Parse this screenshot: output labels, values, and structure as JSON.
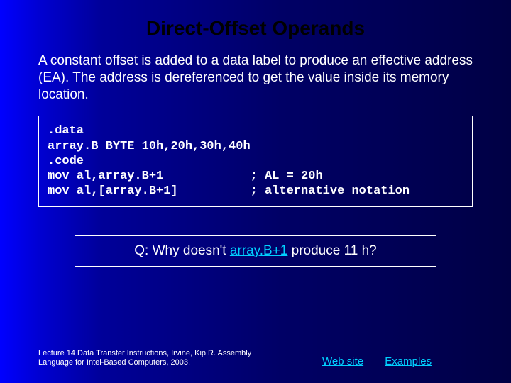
{
  "title": "Direct-Offset Operands",
  "body": "A constant offset is added to a data label to produce an effective address (EA). The address is dereferenced to get the value inside its memory location.",
  "code": ".data\narray.B BYTE 10h,20h,30h,40h\n.code\nmov al,array.B+1            ; AL = 20h\nmov al,[array.B+1]          ; alternative notation",
  "question": {
    "prefix": "Q: Why doesn't ",
    "highlight": "array.B+1",
    "suffix": " produce 11 h?"
  },
  "footer": {
    "citation": "Lecture 14 Data Transfer Instructions, Irvine, Kip R. Assembly Language for Intel-Based Computers, 2003.",
    "link1": "Web site",
    "link2": "Examples"
  }
}
